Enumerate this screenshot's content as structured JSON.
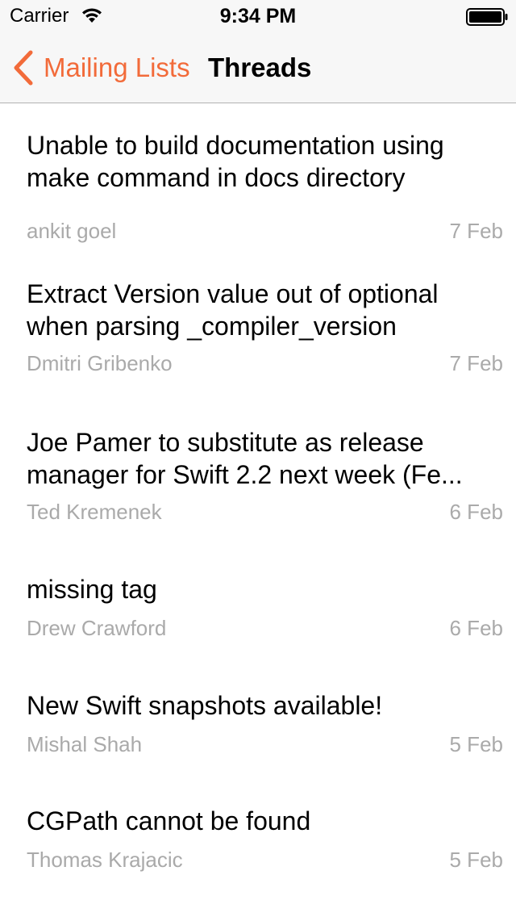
{
  "status_bar": {
    "carrier": "Carrier",
    "time": "9:34 PM",
    "wifi_icon": "wifi-icon",
    "battery_icon": "battery-full-icon"
  },
  "nav": {
    "back_label": "Mailing Lists",
    "back_icon": "chevron-left-icon",
    "title": "Threads",
    "accent_color": "#f26b3a"
  },
  "threads": [
    {
      "title": "Unable to build documentation using make command in docs directory",
      "author": "ankit goel",
      "date": "7 Feb"
    },
    {
      "title": "Extract Version value out of optional when parsing _compiler_version",
      "author": "Dmitri Gribenko",
      "date": "7 Feb"
    },
    {
      "title": "Joe Pamer to substitute as release manager for Swift 2.2 next week (Fe...",
      "author": "Ted Kremenek",
      "date": "6 Feb"
    },
    {
      "title": "missing tag",
      "author": "Drew Crawford",
      "date": "6 Feb"
    },
    {
      "title": "New Swift snapshots available!",
      "author": "Mishal Shah",
      "date": "5 Feb"
    },
    {
      "title": "CGPath cannot be found",
      "author": "Thomas Krajacic",
      "date": "5 Feb"
    }
  ]
}
